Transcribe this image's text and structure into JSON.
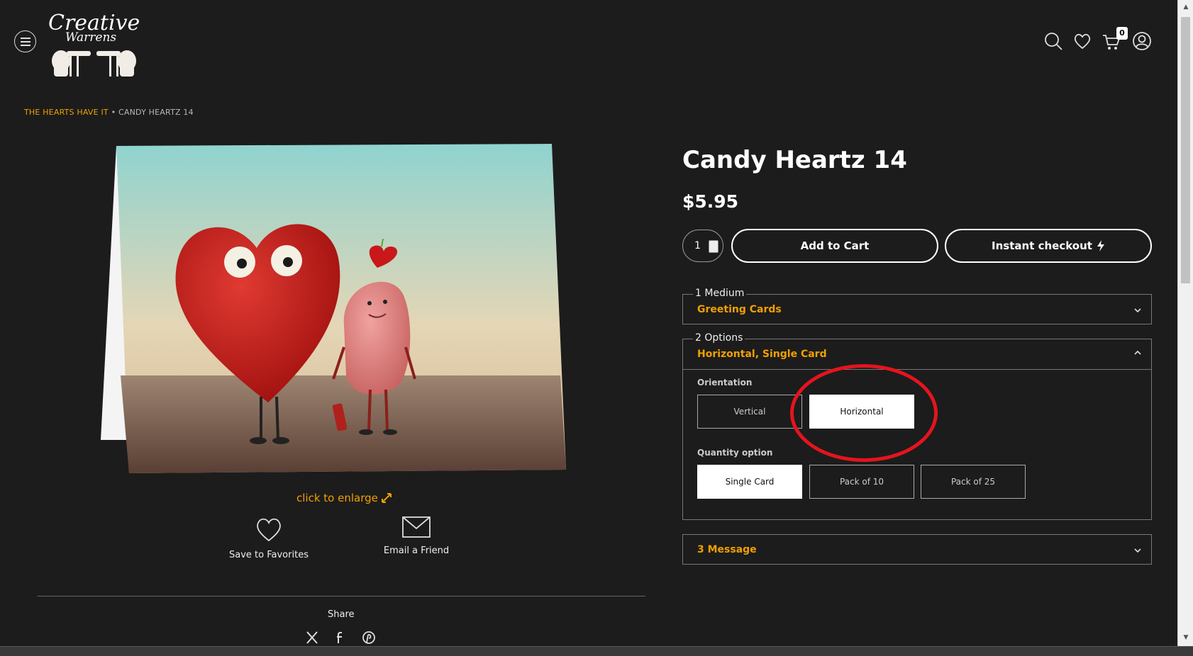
{
  "header": {
    "logo_text_1": "Creative",
    "logo_text_2": "Warrens",
    "menu_icon": "hamburger-icon",
    "icons": [
      "search-icon",
      "heart-icon",
      "cart-icon",
      "user-icon"
    ],
    "cart_count": "0"
  },
  "breadcrumb": {
    "parent": "THE HEARTS HAVE IT",
    "separator": "•",
    "current": "CANDY HEARTZ 14"
  },
  "gallery": {
    "enlarge_label": "click to enlarge",
    "save_label": "Save to Favorites",
    "email_label": "Email a Friend",
    "share_label": "Share",
    "share_icons": [
      "x-icon",
      "facebook-icon",
      "pinterest-icon"
    ]
  },
  "product": {
    "title": "Candy Heartz 14",
    "price": "$5.95",
    "quantity": "1",
    "add_to_cart": "Add to Cart",
    "instant_checkout": "Instant checkout"
  },
  "sections": {
    "medium": {
      "number": "1",
      "label": "Medium",
      "value": "Greeting Cards"
    },
    "options": {
      "number": "2",
      "label": "Options",
      "value": "Horizontal, Single Card",
      "orientation_label": "Orientation",
      "orientation": [
        {
          "label": "Vertical",
          "selected": false
        },
        {
          "label": "Horizontal",
          "selected": true
        }
      ],
      "quantity_label": "Quantity option",
      "quantity_options": [
        {
          "label": "Single Card",
          "selected": true
        },
        {
          "label": "Pack of 10",
          "selected": false
        },
        {
          "label": "Pack of 25",
          "selected": false
        }
      ]
    },
    "message": {
      "number": "3",
      "label": "Message"
    }
  },
  "colors": {
    "accent": "#f0a000",
    "background": "#1c1c1c",
    "annotation": "#e4141e"
  }
}
